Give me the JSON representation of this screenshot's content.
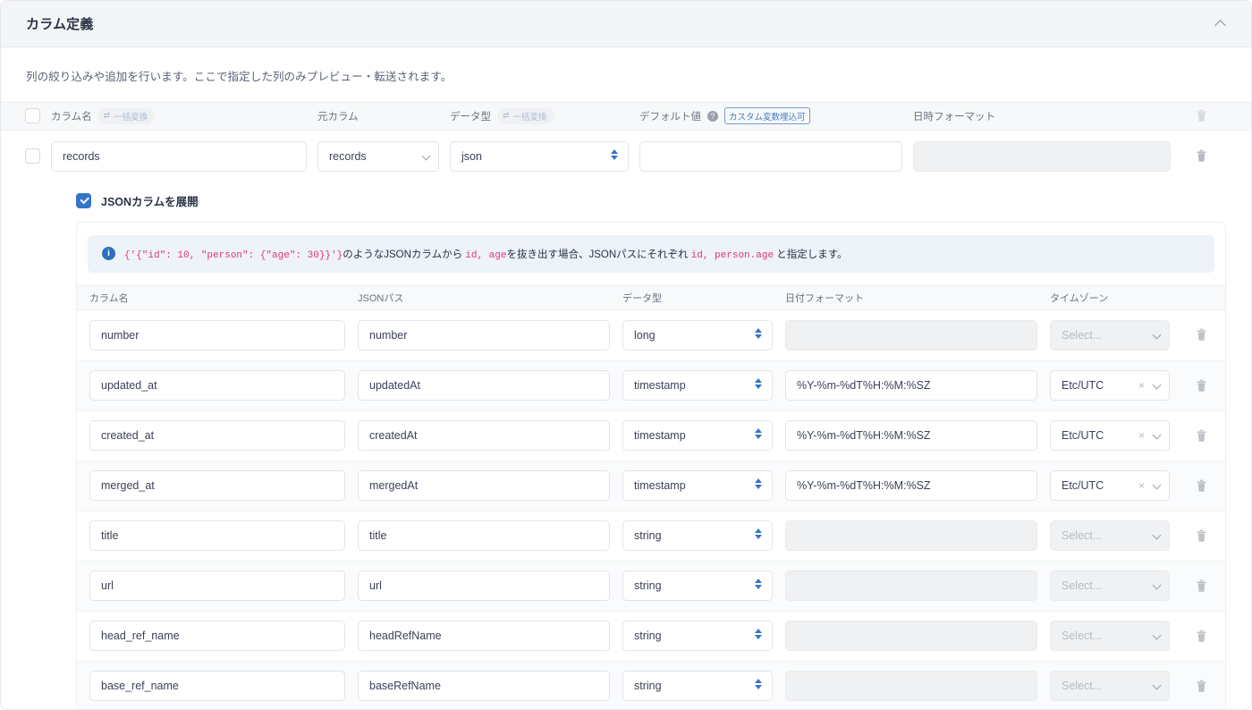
{
  "panel": {
    "title": "カラム定義",
    "collapse_icon": "chevron-up-icon",
    "description": "列の絞り込みや追加を行います。ここで指定した列のみプレビュー・転送されます。"
  },
  "outer_table": {
    "headers": {
      "column_name": "カラム名",
      "source_column": "元カラム",
      "data_type": "データ型",
      "default_value": "デフォルト値",
      "datetime_format": "日時フォーマット"
    },
    "bulk_convert_label": "一括変換",
    "bulk_convert_icon": "swap-icon",
    "help_icon": "question-icon",
    "custom_var_badge": "カスタム変数埋込可",
    "delete_icon": "trash-icon",
    "rows": [
      {
        "checked": false,
        "column_name": "records",
        "source_column": "records",
        "data_type": "json",
        "default_value": "",
        "default_placeholder": "",
        "datetime_format": "",
        "datetime_format_disabled": true
      }
    ]
  },
  "json_expand": {
    "label": "JSONカラムを展開",
    "checked": true
  },
  "info": {
    "icon": "info-icon",
    "part1_code": "{'{\"id\": 10, \"person\": {\"age\": 30}}'}",
    "part2": "のようなJSONカラムから ",
    "part3_code": "id, age",
    "part4": "を抜き出す場合、JSONパスにそれぞれ ",
    "part5_code": "id, person.age",
    "part6": " と指定します。"
  },
  "nested_table": {
    "headers": {
      "column_name": "カラム名",
      "json_path": "JSONパス",
      "data_type": "データ型",
      "date_format": "日付フォーマット",
      "timezone": "タイムゾーン"
    },
    "timezone_placeholder": "Select...",
    "delete_icon": "trash-icon",
    "clear_icon": "clear-x-icon",
    "chevron_icon": "chevron-down-icon",
    "stepper_icon": "stepper-icon",
    "rows": [
      {
        "column_name": "number",
        "json_path": "number",
        "data_type": "long",
        "date_format": "",
        "timezone": "",
        "tz_disabled": true,
        "fmt_disabled": true
      },
      {
        "column_name": "updated_at",
        "json_path": "updatedAt",
        "data_type": "timestamp",
        "date_format": "%Y-%m-%dT%H:%M:%SZ",
        "timezone": "Etc/UTC",
        "tz_disabled": false,
        "fmt_disabled": false
      },
      {
        "column_name": "created_at",
        "json_path": "createdAt",
        "data_type": "timestamp",
        "date_format": "%Y-%m-%dT%H:%M:%SZ",
        "timezone": "Etc/UTC",
        "tz_disabled": false,
        "fmt_disabled": false
      },
      {
        "column_name": "merged_at",
        "json_path": "mergedAt",
        "data_type": "timestamp",
        "date_format": "%Y-%m-%dT%H:%M:%SZ",
        "timezone": "Etc/UTC",
        "tz_disabled": false,
        "fmt_disabled": false
      },
      {
        "column_name": "title",
        "json_path": "title",
        "data_type": "string",
        "date_format": "",
        "timezone": "",
        "tz_disabled": true,
        "fmt_disabled": true
      },
      {
        "column_name": "url",
        "json_path": "url",
        "data_type": "string",
        "date_format": "",
        "timezone": "",
        "tz_disabled": true,
        "fmt_disabled": true
      },
      {
        "column_name": "head_ref_name",
        "json_path": "headRefName",
        "data_type": "string",
        "date_format": "",
        "timezone": "",
        "tz_disabled": true,
        "fmt_disabled": true
      },
      {
        "column_name": "base_ref_name",
        "json_path": "baseRefName",
        "data_type": "string",
        "date_format": "",
        "timezone": "",
        "tz_disabled": true,
        "fmt_disabled": true
      }
    ]
  },
  "colors": {
    "accent": "#3575c9",
    "code_pink": "#e0357f",
    "info_bg": "#eef2f9",
    "badge_blue": "#3f7cc0"
  }
}
